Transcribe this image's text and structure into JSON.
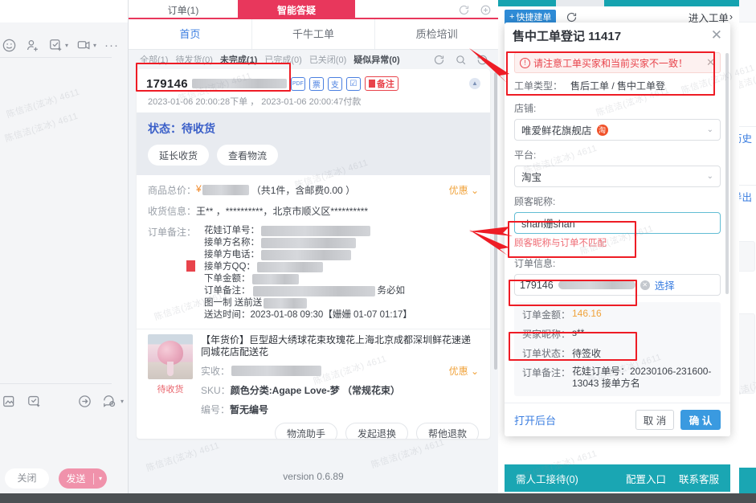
{
  "left_panel": {
    "toolbar_icons": [
      "emoji-icon",
      "add-user-icon",
      "checklist-icon",
      "screenshot-icon",
      "more-icon"
    ],
    "toolbar2_icons": [
      "image-icon",
      "quick-reply-icon",
      "transfer-icon",
      "history-chat-icon"
    ],
    "close_label": "关闭",
    "send_label": "发送",
    "send_caret": "▾"
  },
  "watermark": "陈信洁(泫冰) 4611",
  "middle_panel": {
    "top_tabs": [
      {
        "label": "订单(1)",
        "active": false
      },
      {
        "label": "智能答疑",
        "active": true
      }
    ],
    "top_icons": [
      "refresh-icon",
      "add-icon"
    ],
    "nav": [
      {
        "label": "首页",
        "active": true
      },
      {
        "label": "千牛工单",
        "active": false
      },
      {
        "label": "质检培训",
        "active": false
      }
    ],
    "filters": [
      {
        "label": "全部(1)",
        "bold": false
      },
      {
        "label": "待发货(0)",
        "bold": false
      },
      {
        "label": "未完成(1)",
        "bold": true
      },
      {
        "label": "已完成(0)",
        "bold": false
      },
      {
        "label": "已关闭(0)",
        "bold": false
      },
      {
        "label": "疑似异常(0)",
        "bold": true
      }
    ],
    "filter_icons": [
      "refresh-icon",
      "search-icon",
      "history-icon"
    ],
    "order": {
      "id_visible": "179146",
      "icon_buttons": [
        "pdf-badge",
        "票",
        "支",
        "check-badge"
      ],
      "remark_button": "备注",
      "collapse_icon": "chevron-up-icon",
      "time_line": "2023-01-06 20:00:28下单 ， 2023-01-06 20:00:47付款",
      "status_text": "状态：待收货",
      "status_buttons": [
        "延长收货",
        "查看物流"
      ],
      "total_label": "商品总价：",
      "total_currency": "¥",
      "total_suffix": "（共1件，含邮费0.00 ）",
      "discount_label": "优惠",
      "receiver_label": "收货信息：",
      "receiver_value": "王** ，**********，北京市顺义区**********",
      "order_remark_label": "订单备注：",
      "remark_lines": [
        {
          "label": "花娃订单号：",
          "masked": true
        },
        {
          "label": "接单方名称：",
          "masked": true
        },
        {
          "label": "接单方电话：",
          "masked": true
        },
        {
          "label": "接单方QQ：",
          "masked": true
        },
        {
          "label": "下单金额：",
          "masked": true
        },
        {
          "label": "订单备注：",
          "masked": true,
          "tail": "务必如"
        },
        {
          "label": "图一制 送前送",
          "masked": true
        },
        {
          "label": "送达时间：2023-01-08 09:30【姗姗 01-07 01:17】",
          "masked": false
        }
      ],
      "product": {
        "status_tag": "待收货",
        "title": "【年货价】巨型超大绣球花束玫瑰花上海北京成都深圳鲜花速递同城花店配送花",
        "paid_label": "实收：",
        "paid_discount": "优惠",
        "sku_label": "SKU：",
        "sku_value": "颜色分类:Agape Love-梦 （常规花束）",
        "code_label": "编号：",
        "code_value": "暂无编号",
        "buttons": [
          "物流助手",
          "发起退换",
          "帮他退款"
        ]
      }
    },
    "version": "version 0.6.89"
  },
  "right_panel": {
    "quick_create_label": "快捷建单",
    "quick_create_plus": "+",
    "refresh_icon": "refresh-icon",
    "enter_workorder": "进入工单",
    "enter_chevron": "›",
    "modal": {
      "title": "售中工单登记 11417",
      "close_icon": "close-icon",
      "alert": {
        "icon": "warning-circle-icon",
        "text": "请注意工单买家和当前买家不一致！",
        "close_icon": "close-icon"
      },
      "wo_type_label": "工单类型：",
      "wo_type_value": "售后工单 / 售中工单登",
      "shop_label": "店铺:",
      "shop_value": "唯爱鲜花旗舰店",
      "shop_badge": "淘",
      "platform_label": "平台:",
      "platform_value": "淘宝",
      "nickname_label": "顾客昵称:",
      "nickname_value": "shan姗shan",
      "nickname_error": "顾客昵称与订单不匹配",
      "order_info_label": "订单信息:",
      "order_number_visible": "179146",
      "order_clear_icon": "clear-icon",
      "order_pick_label": "选择",
      "details": [
        {
          "key": "订单金额：",
          "value": "146.16",
          "accent": true
        },
        {
          "key": "买家昵称：",
          "value": "s**",
          "accent": false
        },
        {
          "key": "订单状态：",
          "value": "待签收",
          "accent": false
        },
        {
          "key": "订单备注：",
          "value": "花娃订单号：20230106-231600-13043 接单方名",
          "accent": false
        }
      ],
      "open_backend": "打开后台",
      "cancel_label": "取 消",
      "confirm_label": "确 认"
    },
    "bottom_bar": {
      "left": "需人工接待(0)",
      "config": "配置入口",
      "contact": "联系客服"
    }
  },
  "far_right": {
    "links": [
      "历史",
      "导出"
    ],
    "green_indicator": "online-dot"
  },
  "colors": {
    "accent_pink": "#e8375c",
    "accent_blue": "#3a9ae0",
    "teal": "#1aa6b3",
    "alert_red": "#e8434b",
    "annotation_red": "#ee1c25",
    "amount_orange": "#f0a33c"
  }
}
